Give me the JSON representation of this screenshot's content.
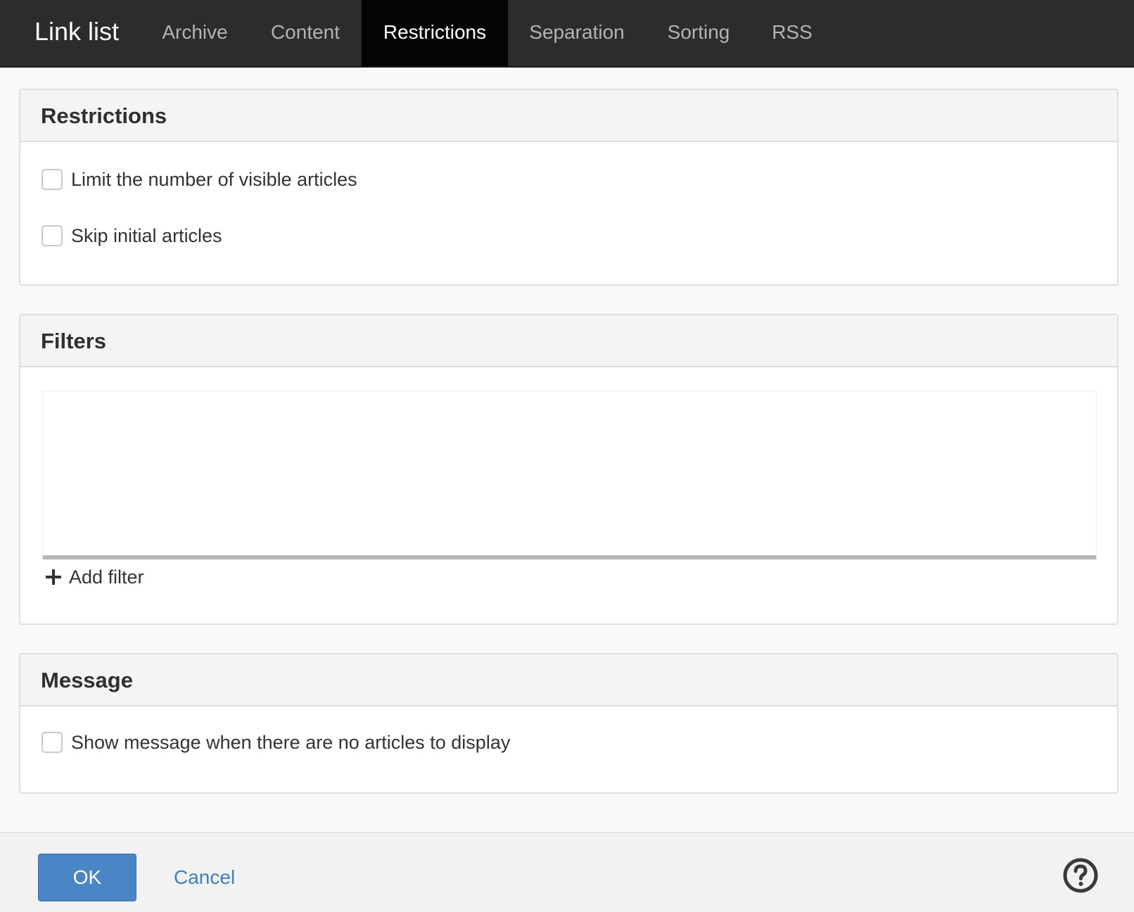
{
  "header": {
    "app_title": "Link list",
    "tabs": [
      {
        "label": "Archive",
        "active": false
      },
      {
        "label": "Content",
        "active": false
      },
      {
        "label": "Restrictions",
        "active": true
      },
      {
        "label": "Separation",
        "active": false
      },
      {
        "label": "Sorting",
        "active": false
      },
      {
        "label": "RSS",
        "active": false
      }
    ]
  },
  "restrictions": {
    "title": "Restrictions",
    "options": [
      {
        "label": "Limit the number of visible articles",
        "checked": false
      },
      {
        "label": "Skip initial articles",
        "checked": false
      }
    ]
  },
  "filters": {
    "title": "Filters",
    "add_label": "Add filter"
  },
  "message": {
    "title": "Message",
    "option": {
      "label": "Show message when there are no articles to display",
      "checked": false
    }
  },
  "footer": {
    "ok_label": "OK",
    "cancel_label": "Cancel",
    "help_icon": "question-circle-icon"
  },
  "colors": {
    "topbar": "#2c2c2c",
    "active_tab": "#050505",
    "ok_button": "#4a86c5",
    "link": "#3d7fc1"
  }
}
